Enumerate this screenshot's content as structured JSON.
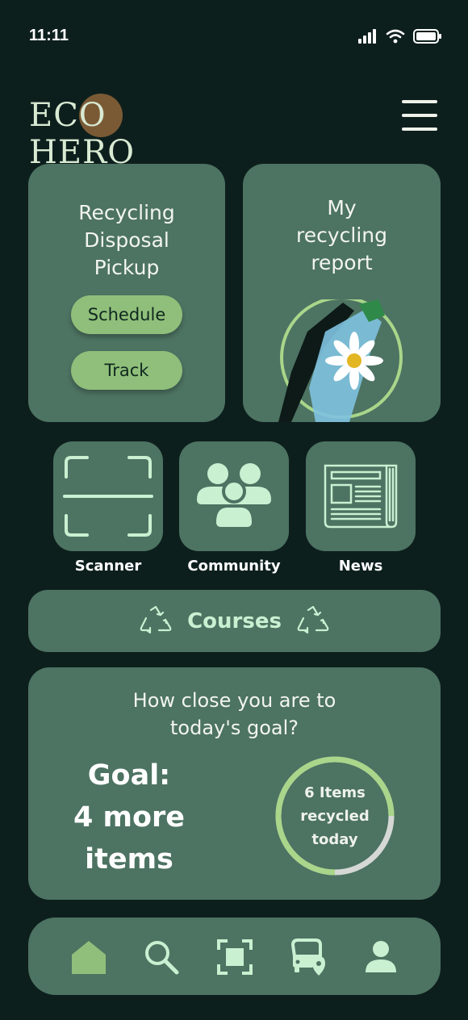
{
  "status": {
    "time": "11:11"
  },
  "brand": {
    "name": "ECO HERO"
  },
  "pickup": {
    "title": "Recycling Disposal Pickup",
    "schedule_label": "Schedule",
    "track_label": "Track"
  },
  "report": {
    "title": "My recycling report"
  },
  "quick_actions": [
    {
      "label": "Scanner",
      "icon": "scanner-icon"
    },
    {
      "label": "Community",
      "icon": "community-icon"
    },
    {
      "label": "News",
      "icon": "newspaper-icon"
    }
  ],
  "courses": {
    "label": "Courses",
    "icon": "recycle-icon"
  },
  "goal": {
    "question": "How close you are to today's goal?",
    "goal_line1": "Goal:",
    "goal_line2": "4 more",
    "goal_line3": "items",
    "ring_line1": "6 Items",
    "ring_line2": "recycled",
    "ring_line3": "today",
    "progress_fraction": 0.75
  },
  "nav": [
    {
      "icon": "home-icon",
      "active": true
    },
    {
      "icon": "search-icon",
      "active": false
    },
    {
      "icon": "scan-icon",
      "active": false
    },
    {
      "icon": "bus-location-icon",
      "active": false
    },
    {
      "icon": "profile-icon",
      "active": false
    }
  ],
  "colors": {
    "background": "#0d1f1d",
    "card": "#4d7362",
    "accent": "#8fbf7a",
    "icon_mint": "#c9f0d1",
    "ring_progress": "#a9d68a",
    "ring_track": "#d5d8d4"
  }
}
